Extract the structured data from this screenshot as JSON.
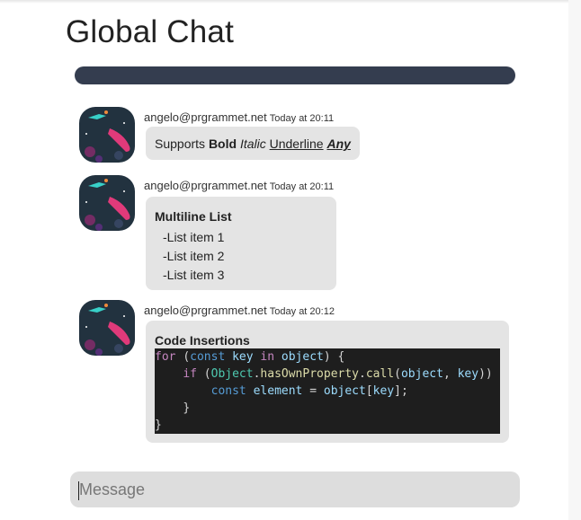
{
  "app": {
    "title": "Global Chat"
  },
  "messages": [
    {
      "author": "angelo@prgrammet.net",
      "time": "Today at 20:11",
      "parts": {
        "prefix": "Supports",
        "bold": "Bold",
        "italic": "Italic",
        "underline": "Underline",
        "any": "Any"
      }
    },
    {
      "author": "angelo@prgrammet.net",
      "time": "Today at 20:11",
      "heading": "Multiline List",
      "items": [
        "-List item 1",
        "-List item 2",
        "-List item 3"
      ]
    },
    {
      "author": "angelo@prgrammet.net",
      "time": "Today at 20:12",
      "heading": "Code Insertions",
      "code_lines": [
        "for (const key in object) {",
        "    if (Object.hasOwnProperty.call(object, key)) {",
        "        const element = object[key];",
        "    }",
        "}"
      ]
    }
  ],
  "composer": {
    "placeholder": "Message",
    "value": ""
  },
  "colors": {
    "bar": "#343d4f",
    "bubble": "#e4e4e4",
    "code_bg": "#1e1e1e"
  }
}
